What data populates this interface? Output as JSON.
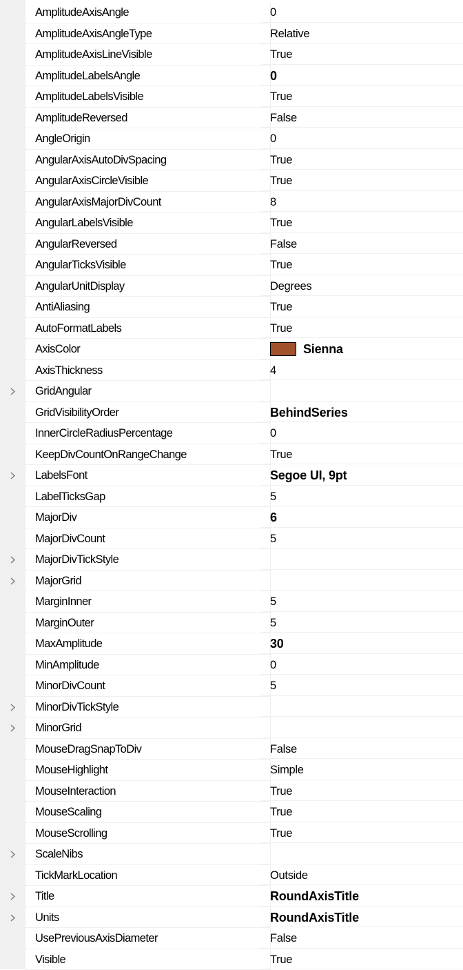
{
  "properties": [
    {
      "name": "AmplitudeAxisAngle",
      "value": "0",
      "bold": false,
      "expandable": false
    },
    {
      "name": "AmplitudeAxisAngleType",
      "value": "Relative",
      "bold": false,
      "expandable": false
    },
    {
      "name": "AmplitudeAxisLineVisible",
      "value": "True",
      "bold": false,
      "expandable": false
    },
    {
      "name": "AmplitudeLabelsAngle",
      "value": "0",
      "bold": true,
      "expandable": false
    },
    {
      "name": "AmplitudeLabelsVisible",
      "value": "True",
      "bold": false,
      "expandable": false
    },
    {
      "name": "AmplitudeReversed",
      "value": "False",
      "bold": false,
      "expandable": false
    },
    {
      "name": "AngleOrigin",
      "value": "0",
      "bold": false,
      "expandable": false
    },
    {
      "name": "AngularAxisAutoDivSpacing",
      "value": "True",
      "bold": false,
      "expandable": false
    },
    {
      "name": "AngularAxisCircleVisible",
      "value": "True",
      "bold": false,
      "expandable": false
    },
    {
      "name": "AngularAxisMajorDivCount",
      "value": "8",
      "bold": false,
      "expandable": false
    },
    {
      "name": "AngularLabelsVisible",
      "value": "True",
      "bold": false,
      "expandable": false
    },
    {
      "name": "AngularReversed",
      "value": "False",
      "bold": false,
      "expandable": false
    },
    {
      "name": "AngularTicksVisible",
      "value": "True",
      "bold": false,
      "expandable": false
    },
    {
      "name": "AngularUnitDisplay",
      "value": "Degrees",
      "bold": false,
      "expandable": false
    },
    {
      "name": "AntiAliasing",
      "value": "True",
      "bold": false,
      "expandable": false
    },
    {
      "name": "AutoFormatLabels",
      "value": "True",
      "bold": false,
      "expandable": false
    },
    {
      "name": "AxisColor",
      "value": "Sienna",
      "bold": true,
      "expandable": false,
      "swatch": "#a0522d"
    },
    {
      "name": "AxisThickness",
      "value": "4",
      "bold": false,
      "expandable": false
    },
    {
      "name": "GridAngular",
      "value": "",
      "bold": false,
      "expandable": true
    },
    {
      "name": "GridVisibilityOrder",
      "value": "BehindSeries",
      "bold": true,
      "expandable": false
    },
    {
      "name": "InnerCircleRadiusPercentage",
      "value": "0",
      "bold": false,
      "expandable": false
    },
    {
      "name": "KeepDivCountOnRangeChange",
      "value": "True",
      "bold": false,
      "expandable": false
    },
    {
      "name": "LabelsFont",
      "value": "Segoe UI, 9pt",
      "bold": true,
      "expandable": true
    },
    {
      "name": "LabelTicksGap",
      "value": "5",
      "bold": false,
      "expandable": false
    },
    {
      "name": "MajorDiv",
      "value": "6",
      "bold": true,
      "expandable": false
    },
    {
      "name": "MajorDivCount",
      "value": "5",
      "bold": false,
      "expandable": false
    },
    {
      "name": "MajorDivTickStyle",
      "value": "",
      "bold": false,
      "expandable": true
    },
    {
      "name": "MajorGrid",
      "value": "",
      "bold": false,
      "expandable": true
    },
    {
      "name": "MarginInner",
      "value": "5",
      "bold": false,
      "expandable": false
    },
    {
      "name": "MarginOuter",
      "value": "5",
      "bold": false,
      "expandable": false
    },
    {
      "name": "MaxAmplitude",
      "value": "30",
      "bold": true,
      "expandable": false
    },
    {
      "name": "MinAmplitude",
      "value": "0",
      "bold": false,
      "expandable": false
    },
    {
      "name": "MinorDivCount",
      "value": "5",
      "bold": false,
      "expandable": false
    },
    {
      "name": "MinorDivTickStyle",
      "value": "",
      "bold": false,
      "expandable": true
    },
    {
      "name": "MinorGrid",
      "value": "",
      "bold": false,
      "expandable": true
    },
    {
      "name": "MouseDragSnapToDiv",
      "value": "False",
      "bold": false,
      "expandable": false
    },
    {
      "name": "MouseHighlight",
      "value": "Simple",
      "bold": false,
      "expandable": false
    },
    {
      "name": "MouseInteraction",
      "value": "True",
      "bold": false,
      "expandable": false
    },
    {
      "name": "MouseScaling",
      "value": "True",
      "bold": false,
      "expandable": false
    },
    {
      "name": "MouseScrolling",
      "value": "True",
      "bold": false,
      "expandable": false
    },
    {
      "name": "ScaleNibs",
      "value": "",
      "bold": false,
      "expandable": true
    },
    {
      "name": "TickMarkLocation",
      "value": "Outside",
      "bold": false,
      "expandable": false
    },
    {
      "name": "Title",
      "value": "RoundAxisTitle",
      "bold": true,
      "expandable": true
    },
    {
      "name": "Units",
      "value": "RoundAxisTitle",
      "bold": true,
      "expandable": true
    },
    {
      "name": "UsePreviousAxisDiameter",
      "value": "False",
      "bold": false,
      "expandable": false
    },
    {
      "name": "Visible",
      "value": "True",
      "bold": false,
      "expandable": false
    }
  ],
  "colors": {
    "gutter": "#f0f0f0",
    "gridline": "#f0f0f0",
    "expander": "#7a7a7a"
  }
}
